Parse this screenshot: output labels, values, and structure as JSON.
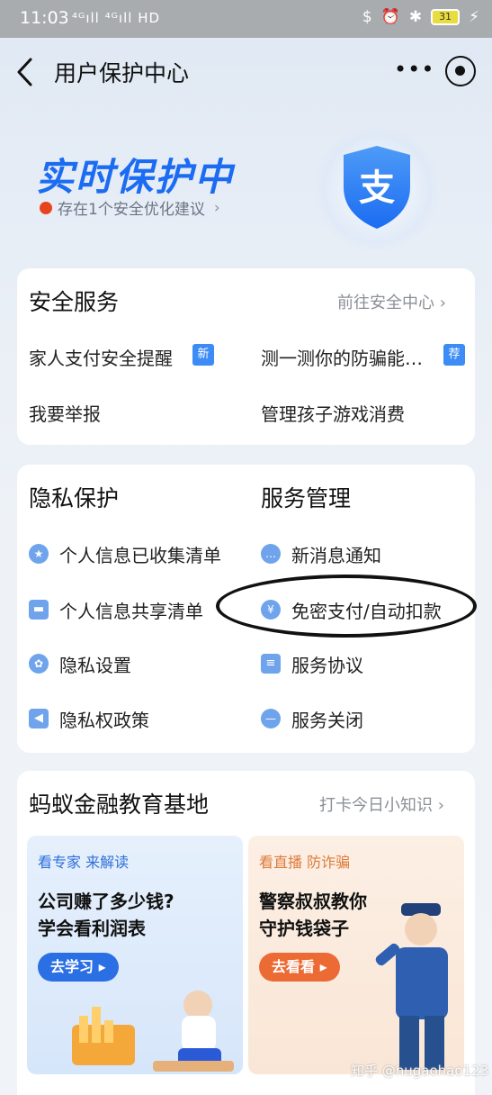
{
  "status_bar": {
    "time": "11:03",
    "network": "⁴ᴳıll ⁴ᴳıll HD",
    "battery": "31"
  },
  "header": {
    "title": "用户保护中心",
    "more_icon": "more-dots-icon",
    "close_icon": "mini-program-close-icon"
  },
  "hero": {
    "title": "实时保护中",
    "subtitle": "存在1个安全优化建议",
    "shield_glyph": "支",
    "status_color": "#e8431f"
  },
  "security_service": {
    "title": "安全服务",
    "link": "前往安全中心",
    "items": [
      {
        "label": "家人支付安全提醒",
        "tag": "新"
      },
      {
        "label": "测一测你的防骗能…",
        "tag": "荐"
      },
      {
        "label": "我要举报"
      },
      {
        "label": "管理孩子游戏消费"
      }
    ]
  },
  "privacy": {
    "title": "隐私保护",
    "items": [
      {
        "label": "个人信息已收集清单",
        "icon": "star-badge-icon"
      },
      {
        "label": "个人信息共享清单",
        "icon": "folder-icon"
      },
      {
        "label": "隐私设置",
        "icon": "gear-icon"
      },
      {
        "label": "隐私权政策",
        "icon": "speaker-icon"
      }
    ]
  },
  "service_mgmt": {
    "title": "服务管理",
    "items": [
      {
        "label": "新消息通知",
        "icon": "chat-bubble-icon"
      },
      {
        "label": "免密支付/自动扣款",
        "icon": "yen-icon"
      },
      {
        "label": "服务协议",
        "icon": "document-icon"
      },
      {
        "label": "服务关闭",
        "icon": "minus-circle-icon"
      }
    ]
  },
  "education": {
    "title": "蚂蚁金融教育基地",
    "link": "打卡今日小知识",
    "cards": [
      {
        "tag": "看专家 来解读",
        "line1": "公司赚了多少钱?",
        "line2": "学会看利润表",
        "button": "去学习 ▸"
      },
      {
        "tag": "看直播 防诈骗",
        "line1": "警察叔叔教你",
        "line2": "守护钱袋子",
        "button": "去看看 ▸"
      }
    ]
  },
  "watermark": "知乎 @hugaohao123",
  "colors": {
    "accent": "#1b6cf2",
    "tag_blue": "#3d8cf5",
    "icon_blue": "#6fa4ec"
  }
}
